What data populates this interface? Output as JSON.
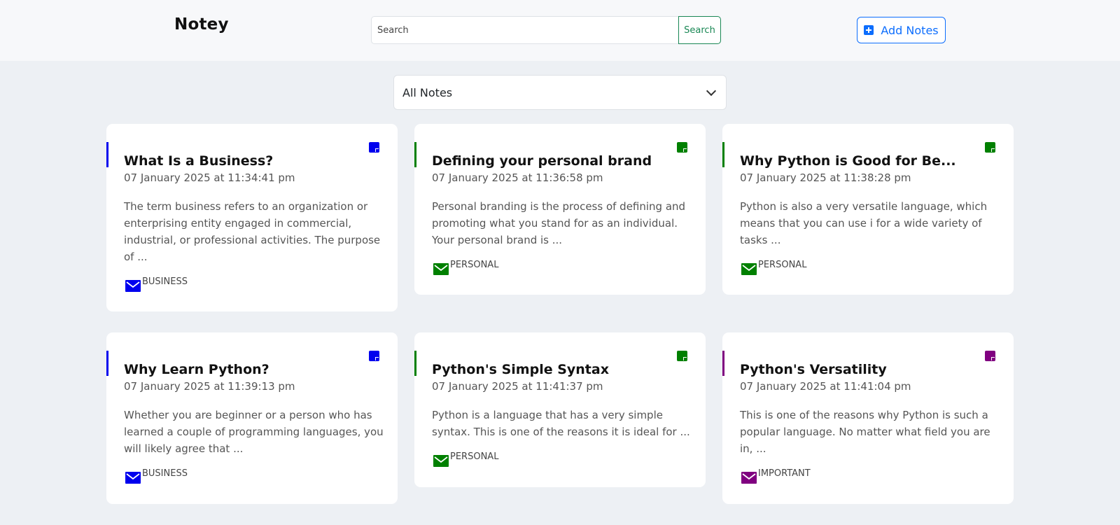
{
  "header": {
    "brand": "Notey",
    "search_placeholder": "Search",
    "search_button": "Search",
    "add_button": "Add Notes"
  },
  "filter": {
    "selected": "All Notes"
  },
  "colors": {
    "business": "#0000ee",
    "personal": "#008000",
    "important": "#800080"
  },
  "notes": [
    {
      "title": "What Is a Business?",
      "date": "07 January 2025 at 11:34:41 pm",
      "body": "The term business refers to an organization or enterprising entity engaged in commercial, industrial, or professional activities. The purpose of ...",
      "tag": "BUSINESS"
    },
    {
      "title": "Defining your personal brand",
      "date": "07 January 2025 at 11:36:58 pm",
      "body": "Personal branding is the process of defining and promoting what you stand for as an individual. Your personal brand is ...",
      "tag": "PERSONAL"
    },
    {
      "title": "Why Python is Good for Be...",
      "date": "07 January 2025 at 11:38:28 pm",
      "body": "Python is also a very versatile language, which means that you can use i for a wide variety of tasks ...",
      "tag": "PERSONAL"
    },
    {
      "title": "Why Learn Python?",
      "date": "07 January 2025 at 11:39:13 pm",
      "body": "Whether you are beginner or a person who has learned a couple of programming languages, you will likely agree that ...",
      "tag": "BUSINESS"
    },
    {
      "title": "Python's Simple Syntax",
      "date": "07 January 2025 at 11:41:37 pm",
      "body": "Python is a language that has a very simple syntax. This is one of the reasons it is ideal for ...",
      "tag": "PERSONAL"
    },
    {
      "title": "Python's Versatility",
      "date": "07 January 2025 at 11:41:04 pm",
      "body": "This is one of the reasons why Python is such a popular language. No matter what field you are in, ...",
      "tag": "IMPORTANT"
    }
  ]
}
